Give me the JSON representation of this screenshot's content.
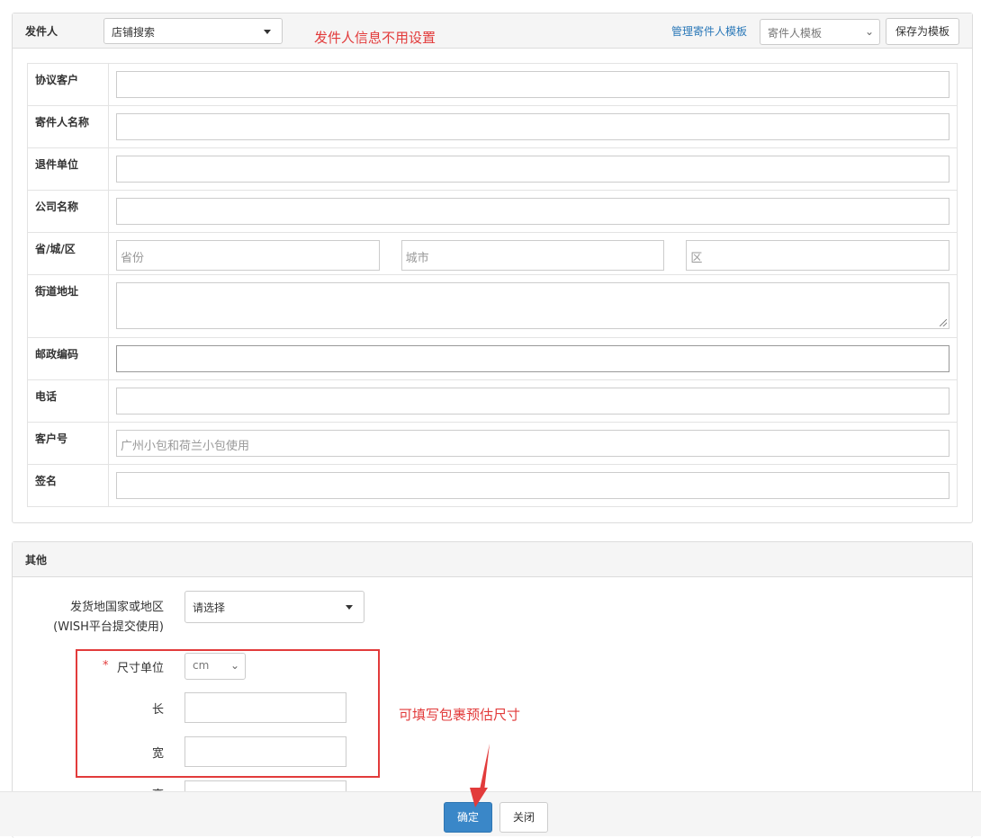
{
  "sender_section": {
    "title": "发件人",
    "store_select": "店铺搜索",
    "note": "发件人信息不用设置",
    "manage_template_link": "管理寄件人模板",
    "template_select_placeholder": "寄件人模板",
    "save_template_button": "保存为模板"
  },
  "form": {
    "rows": [
      {
        "label": "协议客户",
        "value": ""
      },
      {
        "label": "寄件人名称",
        "value": ""
      },
      {
        "label": "退件单位",
        "value": ""
      },
      {
        "label": "公司名称",
        "value": ""
      }
    ],
    "region_label": "省/城/区",
    "province_placeholder": "省份",
    "city_placeholder": "城市",
    "district_placeholder": "区",
    "street_label": "街道地址",
    "postal_label": "邮政编码",
    "phone_label": "电话",
    "customer_no_label": "客户号",
    "customer_no_placeholder": "广州小包和荷兰小包使用",
    "signature_label": "签名"
  },
  "other_section": {
    "title": "其他",
    "origin_label_line1": "发货地国家或地区",
    "origin_label_line2": "(WISH平台提交使用)",
    "origin_select": "请选择",
    "required_mark": "*",
    "size_unit_label": "尺寸单位",
    "size_unit_value": "cm",
    "length_label": "长",
    "width_label": "宽",
    "height_label": "高",
    "size_note": "可填写包裹预估尺寸"
  },
  "footer": {
    "confirm_button": "确定",
    "close_button": "关闭"
  },
  "colors": {
    "annotation": "#e23b3b",
    "primary": "#3a87c8",
    "link": "#2a78b8"
  }
}
